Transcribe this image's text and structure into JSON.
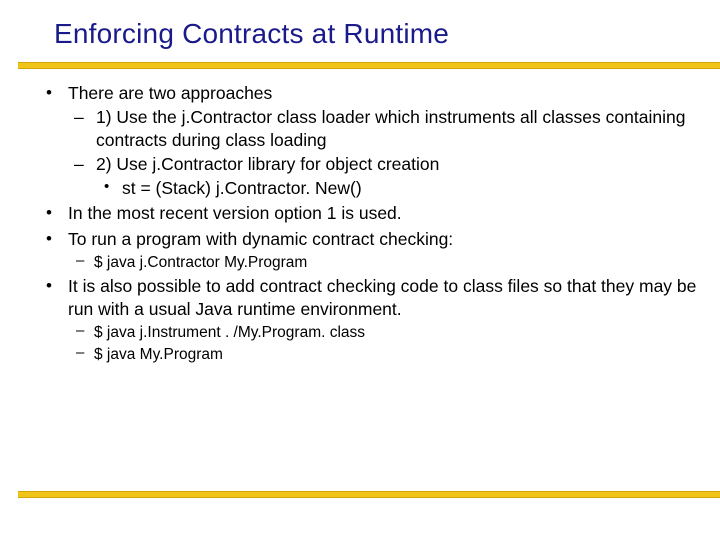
{
  "title": "Enforcing Contracts at Runtime",
  "bullets": {
    "b1": "There are two approaches",
    "b1a": "1) Use the j.Contractor class loader which instruments all classes containing contracts during class loading",
    "b1b": "2) Use j.Contractor library for object creation",
    "b1b1": "st = (Stack) j.Contractor. New()",
    "b2": "In the most recent version option 1 is used.",
    "b3": "To run a program with dynamic contract checking:",
    "b3a": "$ java j.Contractor My.Program",
    "b4": "It is also possible to add contract checking code to class files so that they may be run with a usual Java runtime environment.",
    "b4a": "$ java j.Instrument . /My.Program. class",
    "b4b": "$ java My.Program"
  }
}
